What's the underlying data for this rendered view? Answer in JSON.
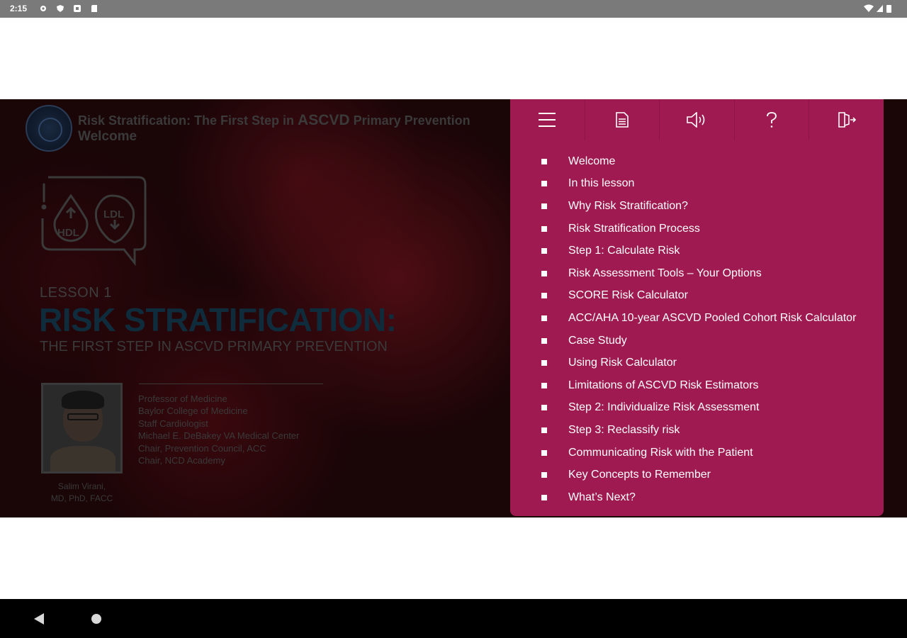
{
  "status_bar": {
    "time": "2:15",
    "left_icons": [
      "settings-icon",
      "shield-icon",
      "screenshot-icon",
      "sd-card-icon"
    ],
    "right_icons": [
      "wifi-icon",
      "cellular-signal-icon",
      "battery-icon"
    ]
  },
  "slide": {
    "course_title_part1": "Risk Stratification: The First Step in ",
    "course_title_part2": "ASCVD",
    "course_title_part3": " Primary Prevention",
    "course_subtitle": "Welcome",
    "lesson_icon_labels": {
      "hdl": "HDL",
      "ldl": "LDL"
    },
    "lesson_number": "LESSON 1",
    "lesson_title": "RISK STRATIFICATION:",
    "lesson_subtitle": "THE FIRST STEP IN ASCVD PRIMARY PREVENTION",
    "presenter_name_line1": "Salim Virani,",
    "presenter_name_line2": "MD, PhD, FACC",
    "credentials": [
      "Professor of Medicine",
      "Baylor College of Medicine",
      "Staff Cardiologist",
      "Michael E. DeBakey VA Medical Center",
      "Chair, Prevention Council, ACC",
      "Chair, NCD Academy"
    ]
  },
  "toolbar": {
    "buttons": [
      "menu-icon",
      "notes-icon",
      "audio-icon",
      "help-icon",
      "exit-icon"
    ]
  },
  "menu": {
    "items": [
      "Welcome",
      "In this lesson",
      "Why Risk Stratification?",
      "Risk Stratification Process",
      "Step 1: Calculate Risk",
      "Risk Assessment Tools – Your Options",
      "SCORE Risk Calculator",
      "ACC/AHA 10-year ASCVD Pooled Cohort Risk Calculator",
      "Case Study",
      "Using Risk Calculator",
      "Limitations of ASCVD Risk Estimators",
      "Step 2: Individualize Risk Assessment",
      "Step 3: Reclassify risk",
      "Communicating Risk with the Patient",
      "Key Concepts to Remember",
      "What’s Next?"
    ]
  },
  "colors": {
    "menu_panel": "#9e1a50",
    "status_bar": "#7a7a7a",
    "nav_bar": "#000000",
    "title_dark_teal": "#0f2c3d"
  }
}
